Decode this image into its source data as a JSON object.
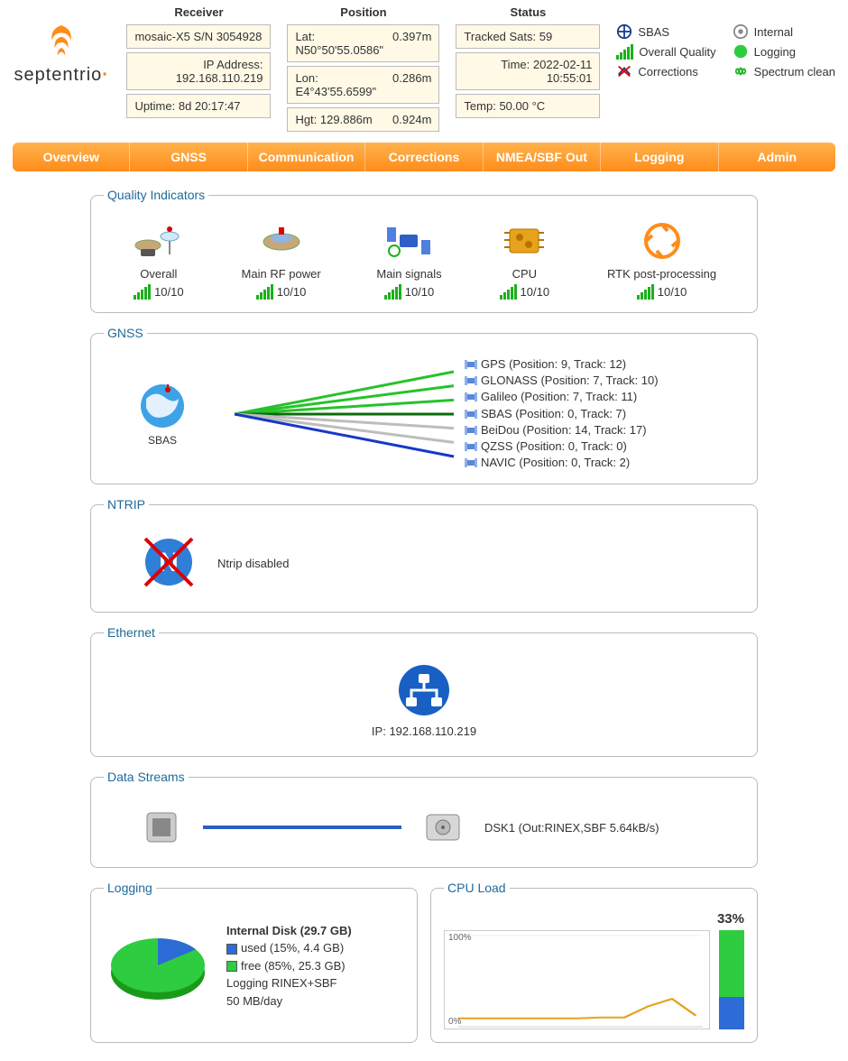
{
  "brand": "septentrio",
  "header": {
    "receiver": {
      "title": "Receiver",
      "model": "mosaic-X5 S/N 3054928",
      "ip_label": "IP Address:",
      "ip": "192.168.110.219",
      "uptime_label": "Uptime:",
      "uptime": "8d 20:17:47"
    },
    "position": {
      "title": "Position",
      "lat_label": "Lat:",
      "lat": "N50°50'55.0586\"",
      "lat_err": "0.397m",
      "lon_label": "Lon:",
      "lon": "E4°43'55.6599\"",
      "lon_err": "0.286m",
      "hgt_label": "Hgt:",
      "hgt": "129.886m",
      "hgt_err": "0.924m"
    },
    "status": {
      "title": "Status",
      "sats_label": "Tracked Sats:",
      "sats": "59",
      "time_label": "Time:",
      "time": "2022-02-11 10:55:01",
      "temp_label": "Temp:",
      "temp": "50.00 °C"
    }
  },
  "legend": {
    "sbas": "SBAS",
    "internal": "Internal",
    "overall": "Overall Quality",
    "logging": "Logging",
    "corrections": "Corrections",
    "spectrum": "Spectrum clean"
  },
  "nav": [
    "Overview",
    "GNSS",
    "Communication",
    "Corrections",
    "NMEA/SBF Out",
    "Logging",
    "Admin"
  ],
  "panels": {
    "qi": {
      "title": "Quality Indicators",
      "items": [
        {
          "name": "Overall",
          "score": "10/10"
        },
        {
          "name": "Main RF power",
          "score": "10/10"
        },
        {
          "name": "Main signals",
          "score": "10/10"
        },
        {
          "name": "CPU",
          "score": "10/10"
        },
        {
          "name": "RTK post-processing",
          "score": "10/10"
        }
      ]
    },
    "gnss": {
      "title": "GNSS",
      "mode": "SBAS",
      "systems": [
        {
          "txt": "GPS (Position: 9, Track: 12)",
          "color": "#27c22a"
        },
        {
          "txt": "GLONASS (Position: 7, Track: 10)",
          "color": "#27c22a"
        },
        {
          "txt": "Galileo (Position: 7, Track: 11)",
          "color": "#27c22a"
        },
        {
          "txt": "SBAS (Position: 0, Track: 7)",
          "color": "#0a6b0a"
        },
        {
          "txt": "BeiDou (Position: 14, Track: 17)",
          "color": "#bdbdbd"
        },
        {
          "txt": "QZSS (Position: 0, Track: 0)",
          "color": "#bdbdbd"
        },
        {
          "txt": "NAVIC (Position: 0, Track: 2)",
          "color": "#1538c9"
        }
      ]
    },
    "ntrip": {
      "title": "NTRIP",
      "text": "Ntrip disabled"
    },
    "ethernet": {
      "title": "Ethernet",
      "ip_label": "IP:",
      "ip": "192.168.110.219"
    },
    "streams": {
      "title": "Data Streams",
      "text": "DSK1 (Out:RINEX,SBF 5.64kB/s)"
    },
    "logging": {
      "title": "Logging",
      "disk_title": "Internal Disk (29.7 GB)",
      "used": "used (15%, 4.4 GB)",
      "free": "free (85%, 25.3 GB)",
      "mode": "Logging RINEX+SBF",
      "rate": "50 MB/day",
      "used_pct": 15
    },
    "cpu": {
      "title": "CPU Load",
      "pct": "33%",
      "value": 33
    }
  },
  "chart_data": [
    {
      "type": "pie",
      "title": "Internal Disk (29.7 GB)",
      "categories": [
        "used",
        "free"
      ],
      "values": [
        15,
        85
      ],
      "colors": [
        "#2d6bd6",
        "#2ecc40"
      ]
    },
    {
      "type": "line",
      "title": "CPU Load",
      "ylabel": "%",
      "ylim": [
        0,
        100
      ],
      "x": [
        "t-100",
        "t-90",
        "t-80",
        "t-70",
        "t-60",
        "t-50",
        "t-40",
        "t-30",
        "t-20",
        "t-10",
        "now"
      ],
      "series": [
        {
          "name": "cpu",
          "values": [
            9,
            9,
            9,
            9,
            9,
            9,
            10,
            10,
            22,
            30,
            12
          ]
        }
      ]
    },
    {
      "type": "bar",
      "title": "CPU Load split",
      "categories": [
        "free",
        "load"
      ],
      "values": [
        67,
        33
      ],
      "colors": [
        "#2ecc40",
        "#2d6bd6"
      ]
    }
  ]
}
